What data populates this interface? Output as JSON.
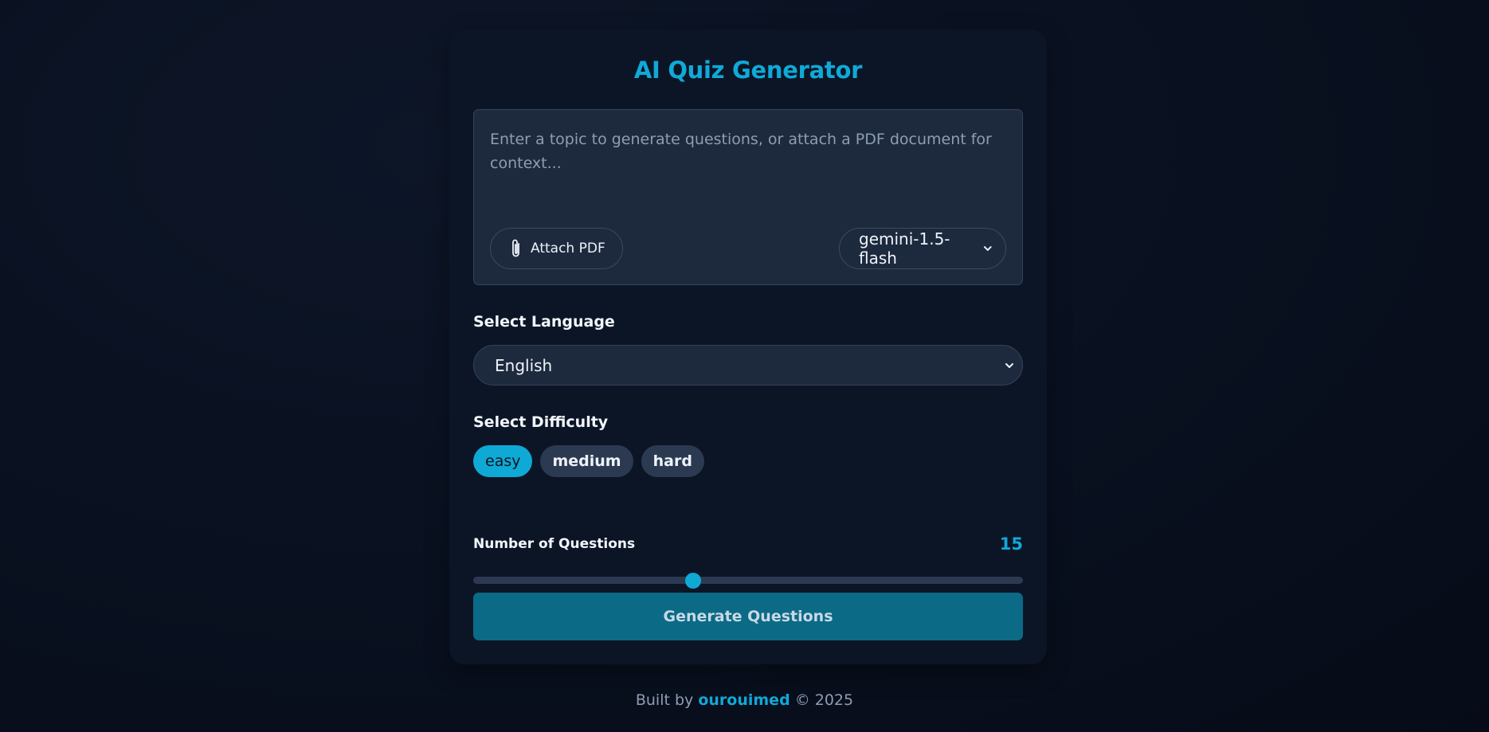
{
  "app": {
    "title": "AI Quiz Generator"
  },
  "prompt": {
    "value": "",
    "placeholder": "Enter a topic to generate questions, or attach a PDF document for context..."
  },
  "attach": {
    "label": "Attach PDF",
    "icon": "paperclip-icon"
  },
  "model": {
    "selected": "gemini-1.5-flash",
    "icon": "chevron-down-icon"
  },
  "language": {
    "label": "Select Language",
    "selected": "English"
  },
  "difficulty": {
    "label": "Select Difficulty",
    "options": [
      "easy",
      "medium",
      "hard"
    ],
    "selected": "easy"
  },
  "questions": {
    "label": "Number of Questions",
    "value": "15",
    "slider_fraction": 0.4
  },
  "generate": {
    "label": "Generate Questions"
  },
  "footer": {
    "prefix": "Built by",
    "author": "ourouimed",
    "suffix": "© 2025"
  },
  "colors": {
    "accent": "#10a9d8",
    "background": "#09101f",
    "card": "#0c1526",
    "input": "#1d2a3e",
    "button": "#0b6a86"
  }
}
